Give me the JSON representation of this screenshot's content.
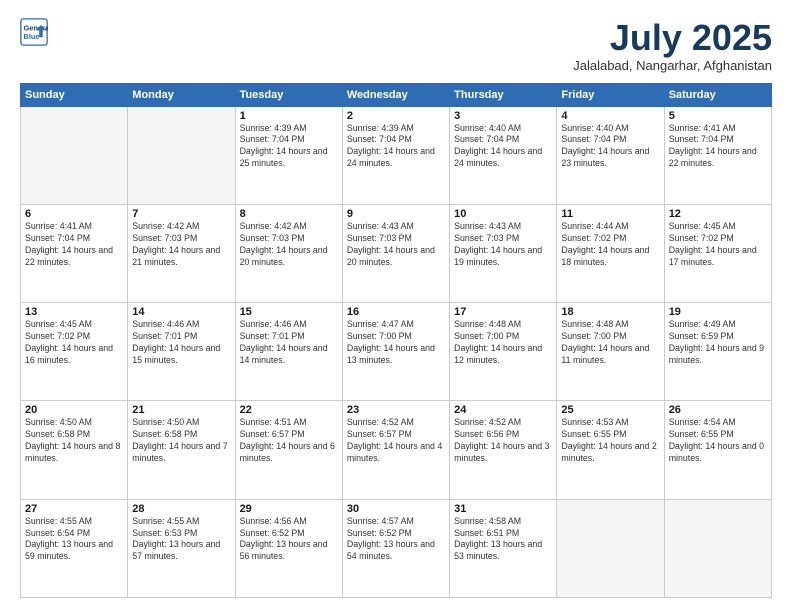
{
  "logo": {
    "line1": "General",
    "line2": "Blue"
  },
  "title": "July 2025",
  "location": "Jalalabad, Nangarhar, Afghanistan",
  "weekdays": [
    "Sunday",
    "Monday",
    "Tuesday",
    "Wednesday",
    "Thursday",
    "Friday",
    "Saturday"
  ],
  "weeks": [
    [
      {
        "day": "",
        "sunrise": "",
        "sunset": "",
        "daylight": ""
      },
      {
        "day": "",
        "sunrise": "",
        "sunset": "",
        "daylight": ""
      },
      {
        "day": "1",
        "sunrise": "Sunrise: 4:39 AM",
        "sunset": "Sunset: 7:04 PM",
        "daylight": "Daylight: 14 hours and 25 minutes."
      },
      {
        "day": "2",
        "sunrise": "Sunrise: 4:39 AM",
        "sunset": "Sunset: 7:04 PM",
        "daylight": "Daylight: 14 hours and 24 minutes."
      },
      {
        "day": "3",
        "sunrise": "Sunrise: 4:40 AM",
        "sunset": "Sunset: 7:04 PM",
        "daylight": "Daylight: 14 hours and 24 minutes."
      },
      {
        "day": "4",
        "sunrise": "Sunrise: 4:40 AM",
        "sunset": "Sunset: 7:04 PM",
        "daylight": "Daylight: 14 hours and 23 minutes."
      },
      {
        "day": "5",
        "sunrise": "Sunrise: 4:41 AM",
        "sunset": "Sunset: 7:04 PM",
        "daylight": "Daylight: 14 hours and 22 minutes."
      }
    ],
    [
      {
        "day": "6",
        "sunrise": "Sunrise: 4:41 AM",
        "sunset": "Sunset: 7:04 PM",
        "daylight": "Daylight: 14 hours and 22 minutes."
      },
      {
        "day": "7",
        "sunrise": "Sunrise: 4:42 AM",
        "sunset": "Sunset: 7:03 PM",
        "daylight": "Daylight: 14 hours and 21 minutes."
      },
      {
        "day": "8",
        "sunrise": "Sunrise: 4:42 AM",
        "sunset": "Sunset: 7:03 PM",
        "daylight": "Daylight: 14 hours and 20 minutes."
      },
      {
        "day": "9",
        "sunrise": "Sunrise: 4:43 AM",
        "sunset": "Sunset: 7:03 PM",
        "daylight": "Daylight: 14 hours and 20 minutes."
      },
      {
        "day": "10",
        "sunrise": "Sunrise: 4:43 AM",
        "sunset": "Sunset: 7:03 PM",
        "daylight": "Daylight: 14 hours and 19 minutes."
      },
      {
        "day": "11",
        "sunrise": "Sunrise: 4:44 AM",
        "sunset": "Sunset: 7:02 PM",
        "daylight": "Daylight: 14 hours and 18 minutes."
      },
      {
        "day": "12",
        "sunrise": "Sunrise: 4:45 AM",
        "sunset": "Sunset: 7:02 PM",
        "daylight": "Daylight: 14 hours and 17 minutes."
      }
    ],
    [
      {
        "day": "13",
        "sunrise": "Sunrise: 4:45 AM",
        "sunset": "Sunset: 7:02 PM",
        "daylight": "Daylight: 14 hours and 16 minutes."
      },
      {
        "day": "14",
        "sunrise": "Sunrise: 4:46 AM",
        "sunset": "Sunset: 7:01 PM",
        "daylight": "Daylight: 14 hours and 15 minutes."
      },
      {
        "day": "15",
        "sunrise": "Sunrise: 4:46 AM",
        "sunset": "Sunset: 7:01 PM",
        "daylight": "Daylight: 14 hours and 14 minutes."
      },
      {
        "day": "16",
        "sunrise": "Sunrise: 4:47 AM",
        "sunset": "Sunset: 7:00 PM",
        "daylight": "Daylight: 14 hours and 13 minutes."
      },
      {
        "day": "17",
        "sunrise": "Sunrise: 4:48 AM",
        "sunset": "Sunset: 7:00 PM",
        "daylight": "Daylight: 14 hours and 12 minutes."
      },
      {
        "day": "18",
        "sunrise": "Sunrise: 4:48 AM",
        "sunset": "Sunset: 7:00 PM",
        "daylight": "Daylight: 14 hours and 11 minutes."
      },
      {
        "day": "19",
        "sunrise": "Sunrise: 4:49 AM",
        "sunset": "Sunset: 6:59 PM",
        "daylight": "Daylight: 14 hours and 9 minutes."
      }
    ],
    [
      {
        "day": "20",
        "sunrise": "Sunrise: 4:50 AM",
        "sunset": "Sunset: 6:58 PM",
        "daylight": "Daylight: 14 hours and 8 minutes."
      },
      {
        "day": "21",
        "sunrise": "Sunrise: 4:50 AM",
        "sunset": "Sunset: 6:58 PM",
        "daylight": "Daylight: 14 hours and 7 minutes."
      },
      {
        "day": "22",
        "sunrise": "Sunrise: 4:51 AM",
        "sunset": "Sunset: 6:57 PM",
        "daylight": "Daylight: 14 hours and 6 minutes."
      },
      {
        "day": "23",
        "sunrise": "Sunrise: 4:52 AM",
        "sunset": "Sunset: 6:57 PM",
        "daylight": "Daylight: 14 hours and 4 minutes."
      },
      {
        "day": "24",
        "sunrise": "Sunrise: 4:52 AM",
        "sunset": "Sunset: 6:56 PM",
        "daylight": "Daylight: 14 hours and 3 minutes."
      },
      {
        "day": "25",
        "sunrise": "Sunrise: 4:53 AM",
        "sunset": "Sunset: 6:55 PM",
        "daylight": "Daylight: 14 hours and 2 minutes."
      },
      {
        "day": "26",
        "sunrise": "Sunrise: 4:54 AM",
        "sunset": "Sunset: 6:55 PM",
        "daylight": "Daylight: 14 hours and 0 minutes."
      }
    ],
    [
      {
        "day": "27",
        "sunrise": "Sunrise: 4:55 AM",
        "sunset": "Sunset: 6:54 PM",
        "daylight": "Daylight: 13 hours and 59 minutes."
      },
      {
        "day": "28",
        "sunrise": "Sunrise: 4:55 AM",
        "sunset": "Sunset: 6:53 PM",
        "daylight": "Daylight: 13 hours and 57 minutes."
      },
      {
        "day": "29",
        "sunrise": "Sunrise: 4:56 AM",
        "sunset": "Sunset: 6:52 PM",
        "daylight": "Daylight: 13 hours and 56 minutes."
      },
      {
        "day": "30",
        "sunrise": "Sunrise: 4:57 AM",
        "sunset": "Sunset: 6:52 PM",
        "daylight": "Daylight: 13 hours and 54 minutes."
      },
      {
        "day": "31",
        "sunrise": "Sunrise: 4:58 AM",
        "sunset": "Sunset: 6:51 PM",
        "daylight": "Daylight: 13 hours and 53 minutes."
      },
      {
        "day": "",
        "sunrise": "",
        "sunset": "",
        "daylight": ""
      },
      {
        "day": "",
        "sunrise": "",
        "sunset": "",
        "daylight": ""
      }
    ]
  ]
}
